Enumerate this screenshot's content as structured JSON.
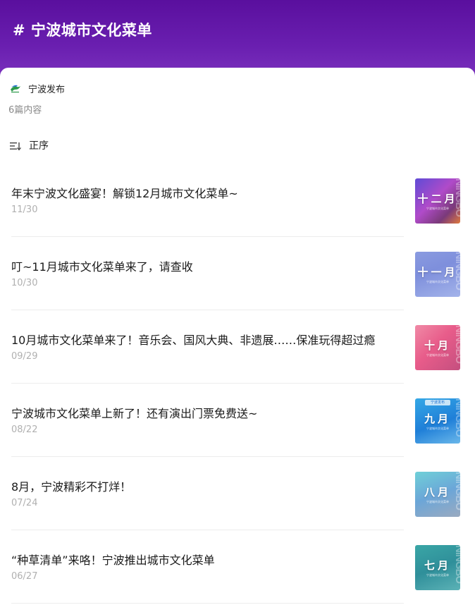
{
  "header": {
    "title": "# 宁波城市文化菜单"
  },
  "account": {
    "name": "宁波发布",
    "logo_icon": "ningbo-fabu-logo"
  },
  "collection": {
    "count_text": "6篇内容"
  },
  "sort": {
    "label": "正序",
    "icon": "sort-order-icon"
  },
  "articles": [
    {
      "title": "年末宁波文化盛宴！解锁12月城市文化菜单~",
      "date": "11/30",
      "thumb_month": "十二月"
    },
    {
      "title": "叮~11月城市文化菜单来了，请查收",
      "date": "10/30",
      "thumb_month": "十一月"
    },
    {
      "title": "10月城市文化菜单来了！音乐会、国风大典、非遗展……保准玩得超过瘾",
      "date": "09/29",
      "thumb_month": "十月"
    },
    {
      "title": "宁波城市文化菜单上新了！还有演出门票免费送~",
      "date": "08/22",
      "thumb_month": "九月",
      "thumb_tag": "宁波发布"
    },
    {
      "title": "8月，宁波精彩不打烊！",
      "date": "07/24",
      "thumb_month": "八月"
    },
    {
      "title": "“种草清单”来咯！宁波推出城市文化菜单",
      "date": "06/27",
      "thumb_month": "七月"
    }
  ],
  "thumb_watermark": "NINGBO",
  "thumb_subtitle": "宁波城市文化菜单",
  "colors": {
    "header_gradient_start": "#5a0f9e",
    "header_gradient_end": "#7a30bd",
    "date_gray": "#b0b0b0"
  }
}
